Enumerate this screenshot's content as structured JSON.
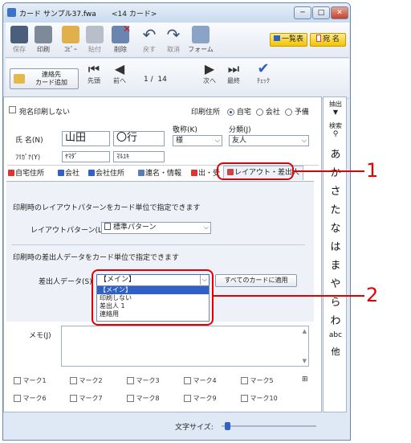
{
  "window": {
    "title": "カード サンプル37.fwa",
    "subtitle": "<14 カード>",
    "min": "─",
    "max": "□",
    "close": "✕"
  },
  "toolbar": {
    "items": [
      "保存",
      "印刷",
      "ｺﾋﾟｰ",
      "貼付",
      "削除",
      "戻す",
      "取消",
      "フォーム"
    ],
    "list_label": "一覧表",
    "atena_label": "宛 名"
  },
  "nav": {
    "add_label_1": "連絡先",
    "add_label_2": "カード追加",
    "first": "先頭",
    "prev": "前へ",
    "position": "1 /  14",
    "next": "次へ",
    "last": "最終",
    "check": "ﾁｪｯｸ"
  },
  "form": {
    "no_print_label": "宛名印刷しない",
    "print_addr_label": "印刷住所",
    "print_addr_options": [
      "自宅",
      "会社",
      "予備"
    ],
    "name_label": "氏 名(N)",
    "last_name": "山田",
    "first_name": "〇行",
    "honorific_label": "敬称(K)",
    "honorific_value": "様",
    "category_label": "分類(J)",
    "category_value": "友人",
    "furigana_label": "ﾌﾘｶﾞﾅ(Y)",
    "furigana_last": "ﾔﾏﾀﾞ",
    "furigana_first": "ﾏﾙﾕｷ"
  },
  "tabs": [
    "自宅住所",
    "会社",
    "会社住所",
    "連名・情報",
    "出・受",
    "レイアウト・差出人"
  ],
  "panel": {
    "layout_desc": "印刷時のレイアウトパターンをカード単位で指定できます",
    "layout_label": "レイアウトパターン(L)",
    "layout_value": "標準パターン",
    "sender_desc": "印刷時の差出人データをカード単位で指定できます",
    "sender_label": "差出人データ(S)",
    "sender_value": "【メイン】",
    "apply_all": "すべてのカードに適用",
    "sender_options": [
      "【メイン】",
      "印刷しない",
      "差出人 1",
      "連絡用"
    ]
  },
  "memo_label": "メモ(J)",
  "marks": [
    "マーク1",
    "マーク2",
    "マーク3",
    "マーク4",
    "マーク5",
    "マーク6",
    "マーク7",
    "マーク8",
    "マーク9",
    "マーク10"
  ],
  "marks_icon": "⊞",
  "font_size_label": "文字サイズ:",
  "sidebar": {
    "extract": "抽出",
    "search": "検索",
    "kana": [
      "あ",
      "か",
      "さ",
      "た",
      "な",
      "は",
      "ま",
      "や",
      "ら",
      "わ",
      "abc",
      "他"
    ]
  },
  "callouts": [
    "1",
    "2"
  ],
  "colors": {
    "accent": "#2f62c4",
    "callout": "#e20000",
    "atena": "#f4b400"
  }
}
